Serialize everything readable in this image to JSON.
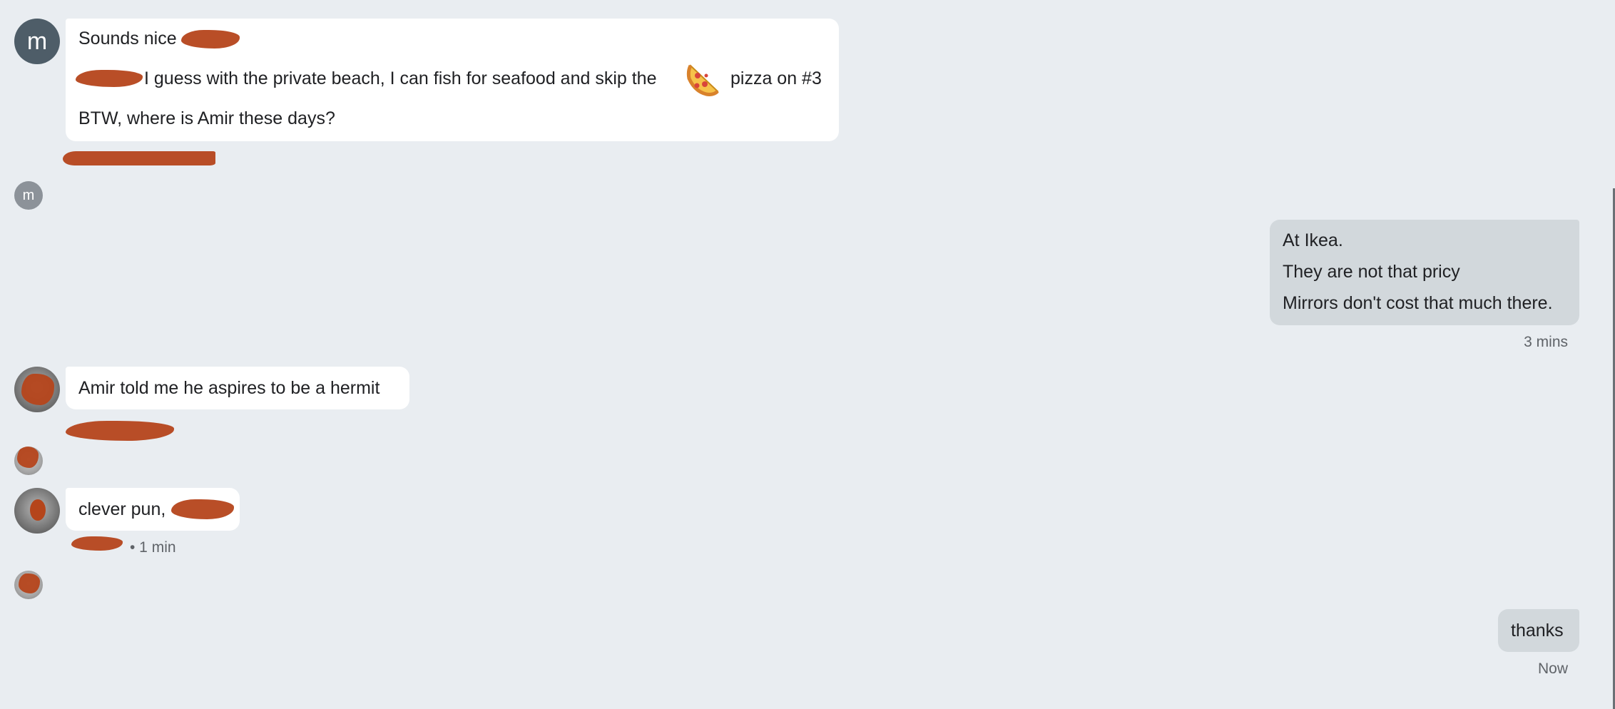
{
  "messages": [
    {
      "id": "msg1",
      "sender_initial": "m",
      "direction": "incoming",
      "lines": [
        "Sounds nice",
        "I guess with the private beach, I can fish for seafood and skip the",
        "pizza on #3",
        "BTW, where is Amir these days?"
      ],
      "emoji": "pizza-emoji"
    },
    {
      "id": "msg2",
      "direction": "outgoing",
      "lines": [
        "At Ikea.",
        "They are not that pricy",
        "Mirrors don't cost that much there."
      ],
      "time": "3 mins"
    },
    {
      "id": "msg3",
      "direction": "incoming",
      "lines": [
        "Amir told me he aspires to be a hermit"
      ]
    },
    {
      "id": "msg4",
      "direction": "incoming",
      "lines": [
        "clever pun,"
      ],
      "meta_suffix": "• 1 min"
    },
    {
      "id": "msg5",
      "direction": "outgoing",
      "lines": [
        "thanks"
      ],
      "time": "Now"
    }
  ],
  "read_receipt_initial": "m",
  "colors": {
    "background": "#e9edf1",
    "incoming_bubble": "#ffffff",
    "outgoing_bubble": "#d2d8dc",
    "redaction": "#b5451b"
  }
}
